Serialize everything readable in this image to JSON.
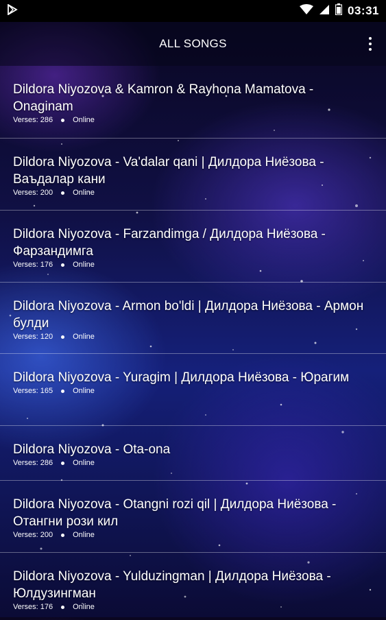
{
  "status_bar": {
    "time": "03:31",
    "left_icon": "play-store-icon",
    "icons": [
      "wifi-icon",
      "signal-icon",
      "battery-icon"
    ]
  },
  "app_bar": {
    "title": "ALL SONGS",
    "menu_icon": "more-vert-icon"
  },
  "songs": [
    {
      "title": "Dildora Niyozova & Kamron & Rayhona Mamatova - Onaginam",
      "verses": "Verses: 286",
      "status": "Online"
    },
    {
      "title": "Dildora Niyozova - Va'dalar qani | Дилдора Ниёзова - Ваъдалар кани",
      "verses": "Verses: 200",
      "status": "Online"
    },
    {
      "title": "Dildora Niyozova - Farzandimga / Дилдора Ниёзова - Фарзандимга",
      "verses": "Verses: 176",
      "status": "Online"
    },
    {
      "title": "Dildora Niyozova - Armon bo'ldi | Дилдора Ниёзова - Армон булди",
      "verses": "Verses: 120",
      "status": "Online"
    },
    {
      "title": "Dildora Niyozova - Yuragim | Дилдора Ниёзова - Юрагим",
      "verses": "Verses: 165",
      "status": "Online"
    },
    {
      "title": "Dildora Niyozova - Ota-ona",
      "verses": "Verses: 286",
      "status": "Online"
    },
    {
      "title": "Dildora Niyozova - Otangni rozi qil | Дилдора Ниёзова - Отангни рози кил",
      "verses": "Verses: 200",
      "status": "Online"
    },
    {
      "title": "Dildora Niyozova - Yulduzingman | Дилдора Ниёзова - Юлдузингман",
      "verses": "Verses: 176",
      "status": "Online"
    }
  ]
}
